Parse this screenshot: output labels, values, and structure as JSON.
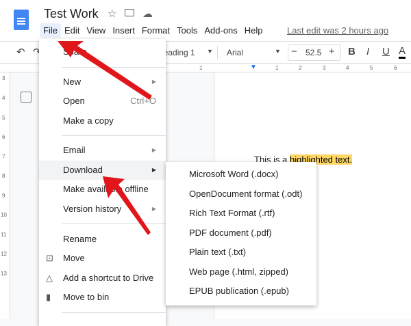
{
  "header": {
    "title": "Test Work",
    "last_edit": "Last edit was 2 hours ago",
    "menus": [
      "File",
      "Edit",
      "View",
      "Insert",
      "Format",
      "Tools",
      "Add-ons",
      "Help"
    ]
  },
  "toolbar": {
    "style": "Heading 1",
    "font": "Arial",
    "font_size": "52.5",
    "minus": "−",
    "plus": "+",
    "bold": "B",
    "italic": "I",
    "underline": "U",
    "color": "A"
  },
  "ruler": {
    "h": [
      "1",
      "1",
      "2",
      "3",
      "4",
      "5",
      "6"
    ],
    "v": [
      "3",
      "4",
      "5",
      "6",
      "7",
      "8",
      "9",
      "10",
      "11",
      "12",
      "13"
    ]
  },
  "document": {
    "text_before": "This is a ",
    "highlighted": "highlighted text.",
    "highlight_color": "#fdd663"
  },
  "file_menu": {
    "share": "Share",
    "new": "New",
    "open": "Open",
    "open_shortcut": "Ctrl+O",
    "copy": "Make a copy",
    "email": "Email",
    "download": "Download",
    "offline": "Make available offline",
    "version": "Version history",
    "rename": "Rename",
    "move": "Move",
    "shortcut": "Add a shortcut to Drive",
    "bin": "Move to bin"
  },
  "download_menu": [
    "Microsoft Word (.docx)",
    "OpenDocument format (.odt)",
    "Rich Text Format (.rtf)",
    "PDF document (.pdf)",
    "Plain text (.txt)",
    "Web page (.html, zipped)",
    "EPUB publication (.epub)"
  ],
  "arrow_color": "#e0161b"
}
